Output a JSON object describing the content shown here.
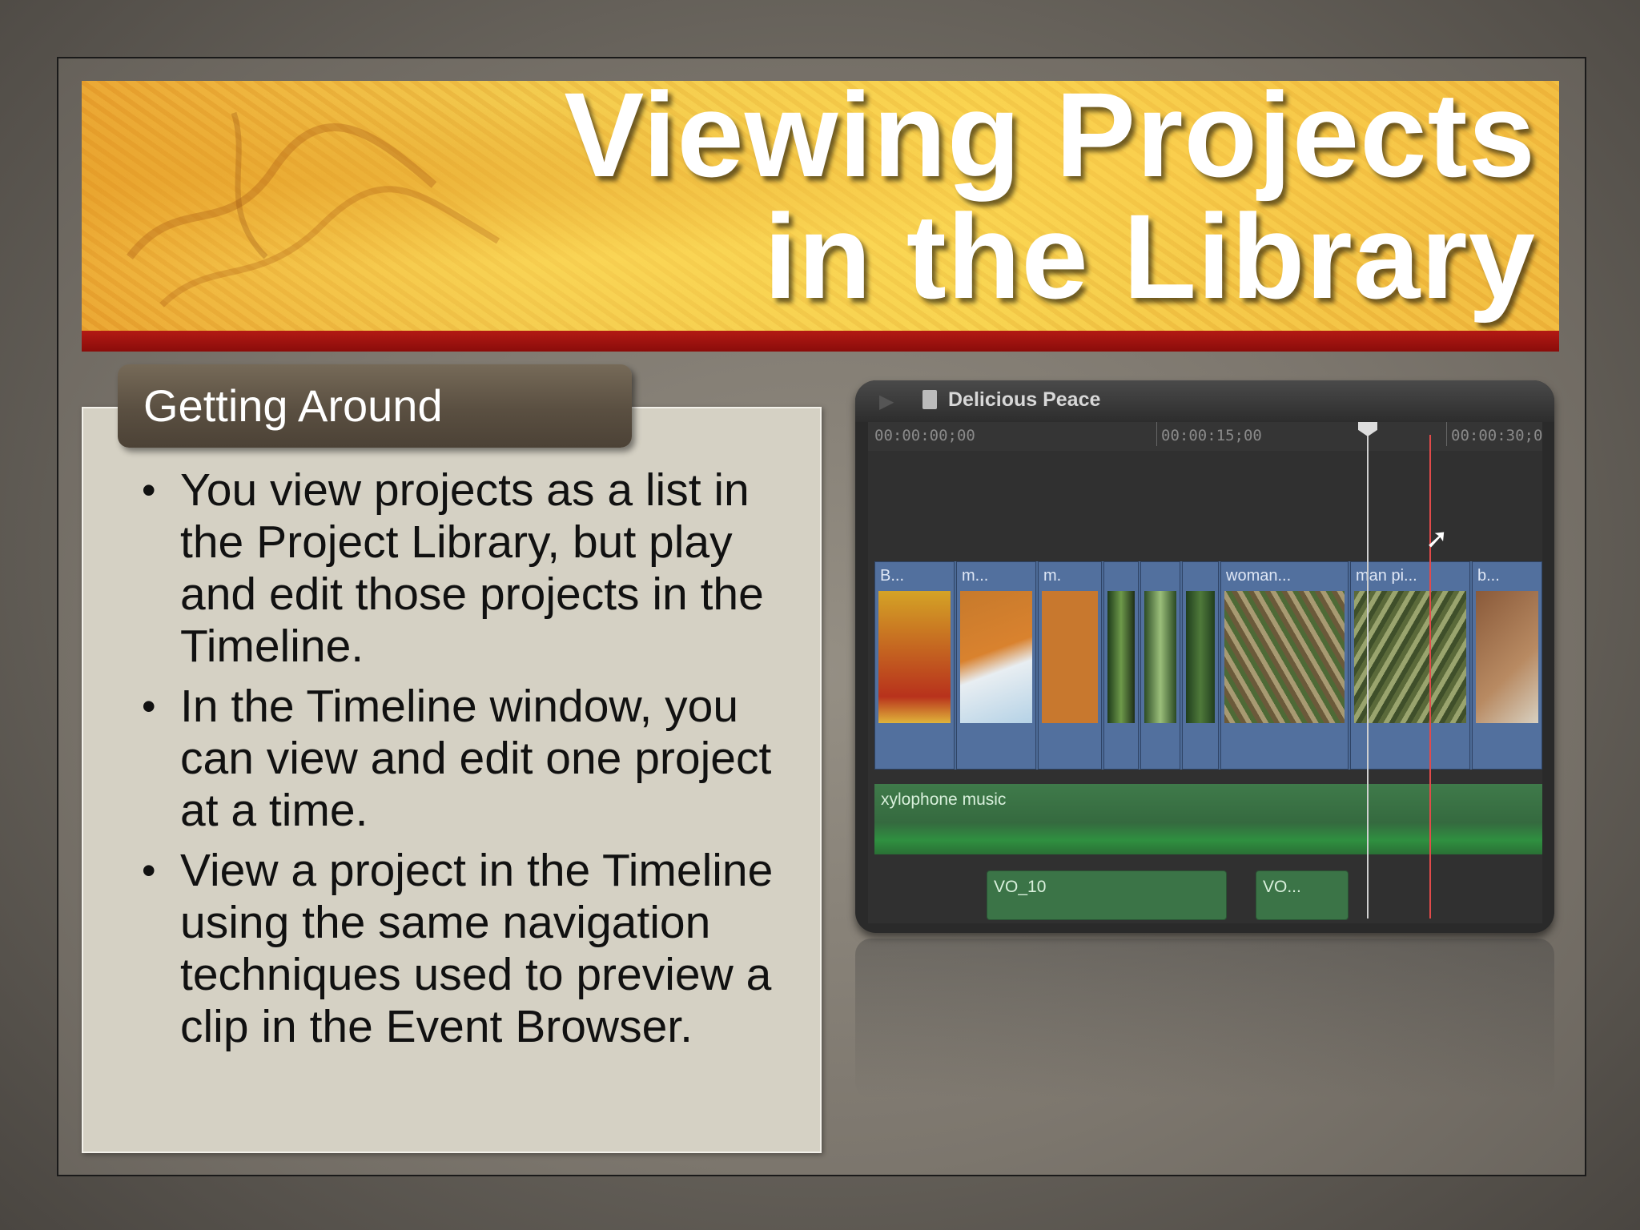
{
  "slide": {
    "title_line1": "Viewing Projects",
    "title_line2": "in the Library",
    "section_tab": "Getting Around",
    "bullets": [
      "You view projects as a list in the Project Library, but play and edit those projects in the Timeline.",
      "In the Timeline window, you can view and edit one project at a time.",
      "View a project in the Timeline using the same navigation techniques used to preview a clip in the Event Browser."
    ],
    "bullet_glyph": "•",
    "colors": {
      "banner_stripe": "#a51410",
      "section_tab": "#5f5446",
      "content_box": "#d5d1c4"
    }
  },
  "timeline": {
    "project_name": "Delicious Peace",
    "ruler": [
      "00:00:00;00",
      "00:00:15;00",
      "00:00:30;0"
    ],
    "video_clips": [
      "B...",
      "m...",
      "m.",
      "woman...",
      "man pi...",
      "b..."
    ],
    "audio_music": "xylophone music",
    "voiceover_clips": [
      "VO_10",
      "VO..."
    ],
    "icons": [
      "play-icon",
      "project-document-icon",
      "playhead-icon",
      "pointer-cursor-icon"
    ]
  }
}
